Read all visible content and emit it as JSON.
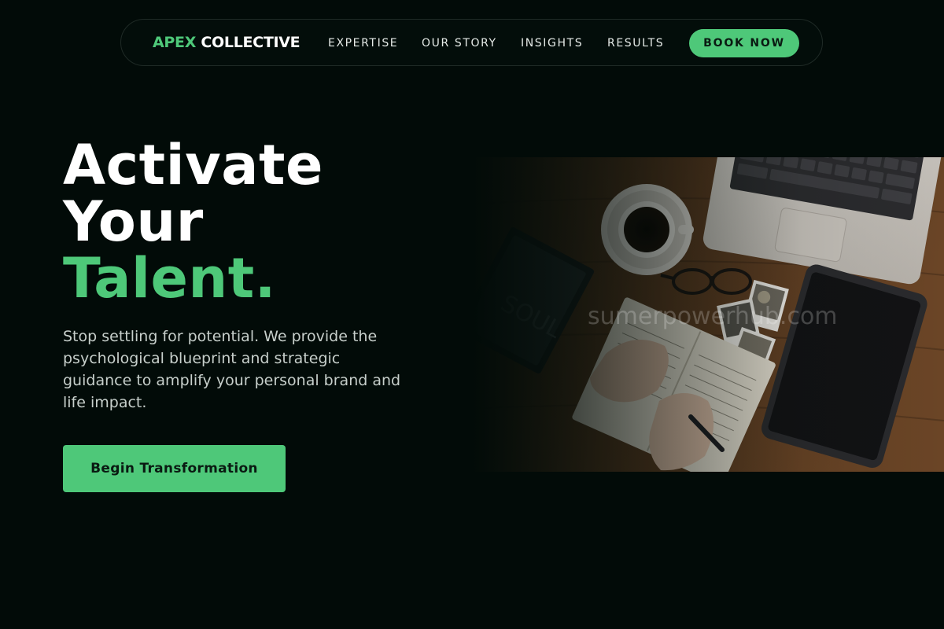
{
  "brand": {
    "accent_word": "APEX",
    "rest_word": "COLLECTIVE"
  },
  "nav": {
    "links": [
      {
        "label": "EXPERTISE"
      },
      {
        "label": "OUR STORY"
      },
      {
        "label": "INSIGHTS"
      },
      {
        "label": "RESULTS"
      }
    ],
    "cta_label": "BOOK NOW"
  },
  "hero": {
    "headline_line1": "Activate",
    "headline_line2": "Your",
    "headline_line3": "Talent.",
    "description": "Stop settling for potential. We provide the psychological blueprint and strategic guidance to amplify your personal brand and life impact.",
    "cta_label": "Begin Transformation"
  },
  "image": {
    "watermark": "sumerpowerhub.com"
  },
  "colors": {
    "background": "#020b08",
    "accent": "#4ec879",
    "text_primary": "#ffffff",
    "text_secondary": "#c7cfcb"
  }
}
